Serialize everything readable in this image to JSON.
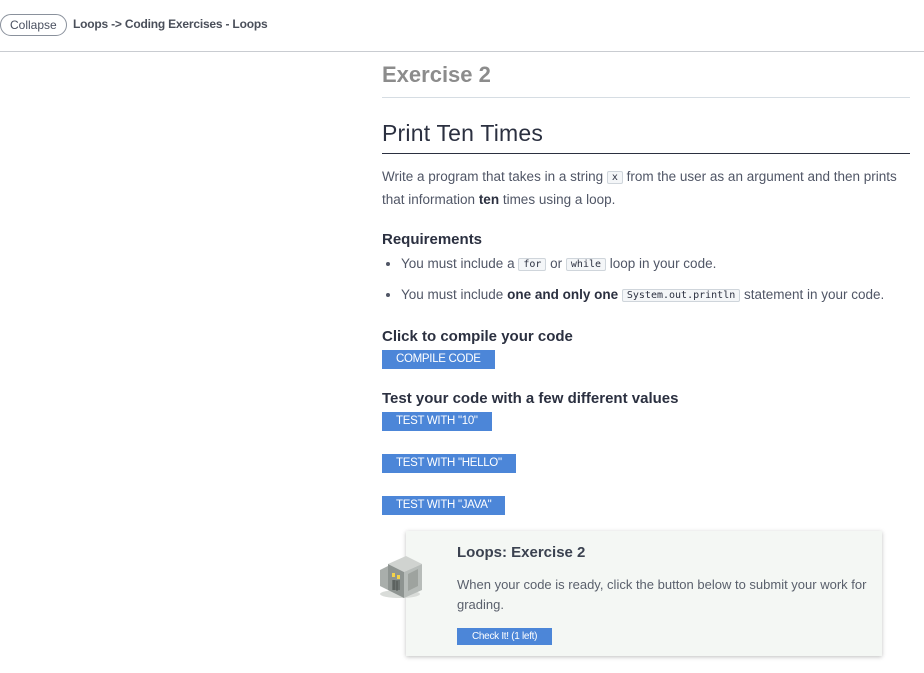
{
  "header": {
    "collapse_label": "Collapse",
    "breadcrumb": "Loops -> Coding Exercises - Loops"
  },
  "exercise": {
    "label": "Exercise 2",
    "title": "Print Ten Times",
    "description": {
      "part1": "Write a program that takes in a string ",
      "code": "x",
      "part2": " from the user as an argument and then prints that information ",
      "bold": "ten",
      "part3": " times using a loop."
    }
  },
  "requirements": {
    "heading": "Requirements",
    "items": [
      {
        "part1": "You must include a ",
        "code1": "for",
        "part2": " or ",
        "code2": "while",
        "part3": " loop in your code."
      },
      {
        "part1": "You must include ",
        "bold": "one and only one",
        "part2": " ",
        "code": "System.out.println",
        "part3": " statement in your code."
      }
    ]
  },
  "compile": {
    "heading": "Click to compile your code",
    "button_label": "COMPILE CODE"
  },
  "test": {
    "heading": "Test your code with a few different values",
    "buttons": [
      "TEST WITH \"10\"",
      "TEST WITH \"HELLO\"",
      "TEST WITH \"JAVA\""
    ]
  },
  "grading": {
    "title": "Loops: Exercise 2",
    "text": "When your code is ready, click the button below to submit your work for grading.",
    "button_label": "Check It! (1 left)",
    "icon": "grader-machine-icon"
  },
  "colors": {
    "accent": "#4c86d8",
    "card_bg": "#f4f7f4"
  }
}
